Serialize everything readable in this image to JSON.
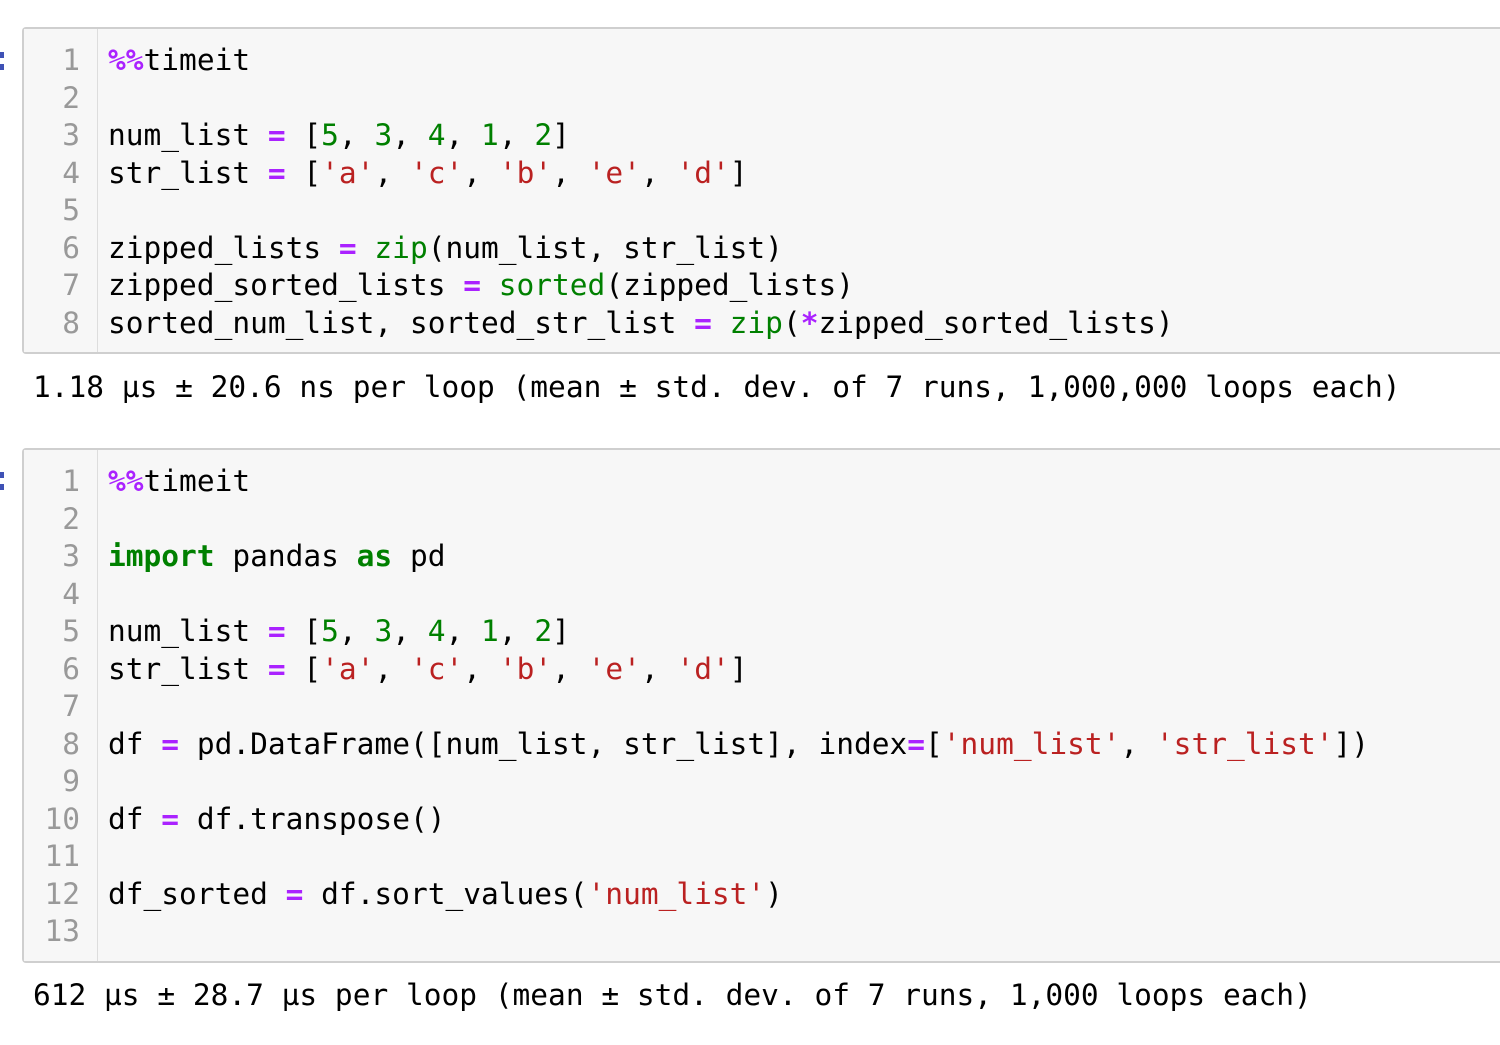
{
  "cells": [
    {
      "lines": [
        {
          "n": "1",
          "tokens": [
            [
              "magic",
              "%%"
            ],
            [
              "plain",
              "timeit"
            ]
          ]
        },
        {
          "n": "2",
          "tokens": []
        },
        {
          "n": "3",
          "tokens": [
            [
              "plain",
              "num_list "
            ],
            [
              "op",
              "="
            ],
            [
              "plain",
              " ["
            ],
            [
              "num",
              "5"
            ],
            [
              "plain",
              ", "
            ],
            [
              "num",
              "3"
            ],
            [
              "plain",
              ", "
            ],
            [
              "num",
              "4"
            ],
            [
              "plain",
              ", "
            ],
            [
              "num",
              "1"
            ],
            [
              "plain",
              ", "
            ],
            [
              "num",
              "2"
            ],
            [
              "plain",
              "]"
            ]
          ]
        },
        {
          "n": "4",
          "tokens": [
            [
              "plain",
              "str_list "
            ],
            [
              "op",
              "="
            ],
            [
              "plain",
              " ["
            ],
            [
              "str",
              "'a'"
            ],
            [
              "plain",
              ", "
            ],
            [
              "str",
              "'c'"
            ],
            [
              "plain",
              ", "
            ],
            [
              "str",
              "'b'"
            ],
            [
              "plain",
              ", "
            ],
            [
              "str",
              "'e'"
            ],
            [
              "plain",
              ", "
            ],
            [
              "str",
              "'d'"
            ],
            [
              "plain",
              "]"
            ]
          ]
        },
        {
          "n": "5",
          "tokens": []
        },
        {
          "n": "6",
          "tokens": [
            [
              "plain",
              "zipped_lists "
            ],
            [
              "op",
              "="
            ],
            [
              "plain",
              " "
            ],
            [
              "bi",
              "zip"
            ],
            [
              "plain",
              "(num_list, str_list)"
            ]
          ]
        },
        {
          "n": "7",
          "tokens": [
            [
              "plain",
              "zipped_sorted_lists "
            ],
            [
              "op",
              "="
            ],
            [
              "plain",
              " "
            ],
            [
              "bi",
              "sorted"
            ],
            [
              "plain",
              "(zipped_lists)"
            ]
          ]
        },
        {
          "n": "8",
          "tokens": [
            [
              "plain",
              "sorted_num_list, sorted_str_list "
            ],
            [
              "op",
              "="
            ],
            [
              "plain",
              " "
            ],
            [
              "bi",
              "zip"
            ],
            [
              "plain",
              "("
            ],
            [
              "op",
              "*"
            ],
            [
              "plain",
              "zipped_sorted_lists)"
            ]
          ]
        }
      ],
      "output": "1.18 µs ± 20.6 ns per loop (mean ± std. dev. of 7 runs, 1,000,000 loops each)"
    },
    {
      "lines": [
        {
          "n": "1",
          "tokens": [
            [
              "magic",
              "%%"
            ],
            [
              "plain",
              "timeit"
            ]
          ]
        },
        {
          "n": "2",
          "tokens": []
        },
        {
          "n": "3",
          "tokens": [
            [
              "kw",
              "import"
            ],
            [
              "plain",
              " pandas "
            ],
            [
              "kw",
              "as"
            ],
            [
              "plain",
              " pd"
            ]
          ]
        },
        {
          "n": "4",
          "tokens": []
        },
        {
          "n": "5",
          "tokens": [
            [
              "plain",
              "num_list "
            ],
            [
              "op",
              "="
            ],
            [
              "plain",
              " ["
            ],
            [
              "num",
              "5"
            ],
            [
              "plain",
              ", "
            ],
            [
              "num",
              "3"
            ],
            [
              "plain",
              ", "
            ],
            [
              "num",
              "4"
            ],
            [
              "plain",
              ", "
            ],
            [
              "num",
              "1"
            ],
            [
              "plain",
              ", "
            ],
            [
              "num",
              "2"
            ],
            [
              "plain",
              "]"
            ]
          ]
        },
        {
          "n": "6",
          "tokens": [
            [
              "plain",
              "str_list "
            ],
            [
              "op",
              "="
            ],
            [
              "plain",
              " ["
            ],
            [
              "str",
              "'a'"
            ],
            [
              "plain",
              ", "
            ],
            [
              "str",
              "'c'"
            ],
            [
              "plain",
              ", "
            ],
            [
              "str",
              "'b'"
            ],
            [
              "plain",
              ", "
            ],
            [
              "str",
              "'e'"
            ],
            [
              "plain",
              ", "
            ],
            [
              "str",
              "'d'"
            ],
            [
              "plain",
              "]"
            ]
          ]
        },
        {
          "n": "7",
          "tokens": []
        },
        {
          "n": "8",
          "tokens": [
            [
              "plain",
              "df "
            ],
            [
              "op",
              "="
            ],
            [
              "plain",
              " pd.DataFrame([num_list, str_list], index"
            ],
            [
              "op",
              "="
            ],
            [
              "plain",
              "["
            ],
            [
              "str",
              "'num_list'"
            ],
            [
              "plain",
              ", "
            ],
            [
              "str",
              "'str_list'"
            ],
            [
              "plain",
              "])"
            ]
          ]
        },
        {
          "n": "9",
          "tokens": []
        },
        {
          "n": "10",
          "tokens": [
            [
              "plain",
              "df "
            ],
            [
              "op",
              "="
            ],
            [
              "plain",
              " df.transpose()"
            ]
          ]
        },
        {
          "n": "11",
          "tokens": []
        },
        {
          "n": "12",
          "tokens": [
            [
              "plain",
              "df_sorted "
            ],
            [
              "op",
              "="
            ],
            [
              "plain",
              " df.sort_values("
            ],
            [
              "str",
              "'num_list'"
            ],
            [
              "plain",
              ")"
            ]
          ]
        },
        {
          "n": "13",
          "tokens": []
        }
      ],
      "output": "612 µs ± 28.7 µs per loop (mean ± std. dev. of 7 runs, 1,000 loops each)"
    }
  ]
}
